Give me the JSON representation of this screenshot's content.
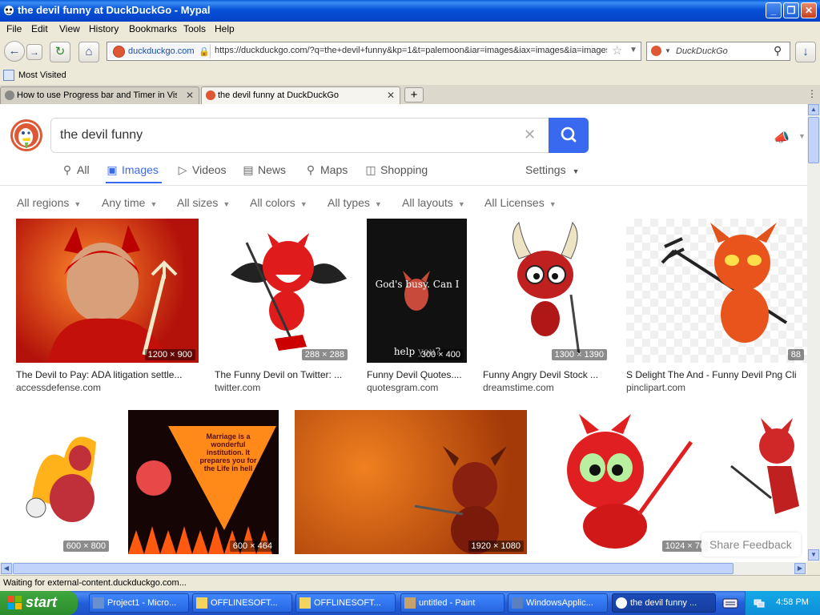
{
  "window": {
    "title": "the devil funny at DuckDuckGo - Mypal",
    "min": "_",
    "max": "❐",
    "close": "✕"
  },
  "menu": [
    "File",
    "Edit",
    "View",
    "History",
    "Bookmarks",
    "Tools",
    "Help"
  ],
  "url": {
    "site": "duckduckgo.com",
    "full": "https://duckduckgo.com/?q=the+devil+funny&kp=1&t=palemoon&iar=images&iax=images&ia=images"
  },
  "browser_search": {
    "placeholder": "DuckDuckGo"
  },
  "bookmarks": {
    "most_visited": "Most Visited"
  },
  "tabs": [
    {
      "label": "How to use Progress bar and Timer in Vis...",
      "active": false
    },
    {
      "label": "the devil funny at DuckDuckGo",
      "active": true
    }
  ],
  "ddg": {
    "query": "the devil funny",
    "nav": [
      "All",
      "Images",
      "Videos",
      "News",
      "Maps",
      "Shopping"
    ],
    "settings": "Settings",
    "filters": [
      "All regions",
      "Any time",
      "All sizes",
      "All colors",
      "All types",
      "All layouts",
      "All Licenses"
    ],
    "share_feedback": "Share Feedback"
  },
  "results_row1": [
    {
      "title": "The Devil to Pay: ADA litigation settle...",
      "source": "accessdefense.com",
      "dims": "1200 × 900"
    },
    {
      "title": "The Funny Devil on Twitter: ...",
      "source": "twitter.com",
      "dims": "288 × 288"
    },
    {
      "title": "Funny Devil Quotes....",
      "source": "quotesgram.com",
      "dims": "300 × 400",
      "caption": "God's busy. Can I help you?"
    },
    {
      "title": "Funny Angry Devil Stock ...",
      "source": "dreamstime.com",
      "dims": "1300 × 1390"
    },
    {
      "title": "S Delight The And - Funny Devil Png Cli",
      "source": "pinclipart.com",
      "dims": "88"
    }
  ],
  "results_row2": [
    {
      "dims": "600 × 800"
    },
    {
      "dims": "600 × 464",
      "caption": "Marriage is a wonderful institution. It prepares you for the Life in hell"
    },
    {
      "dims": "1920 × 1080"
    },
    {
      "dims": "1024 × 76"
    },
    {
      "dims": ""
    }
  ],
  "status": "Waiting for external-content.duckduckgo.com...",
  "taskbar": {
    "start": "start",
    "items": [
      "Project1 - Micro...",
      "OFFLINESOFT...",
      "OFFLINESOFT...",
      "untitled - Paint",
      "WindowsApplic...",
      "the devil funny ..."
    ],
    "clock": "4:58 PM"
  },
  "colors": {
    "accent": "#3969ef",
    "ddg_orange": "#de5833",
    "xp_blue": "#245edb"
  }
}
